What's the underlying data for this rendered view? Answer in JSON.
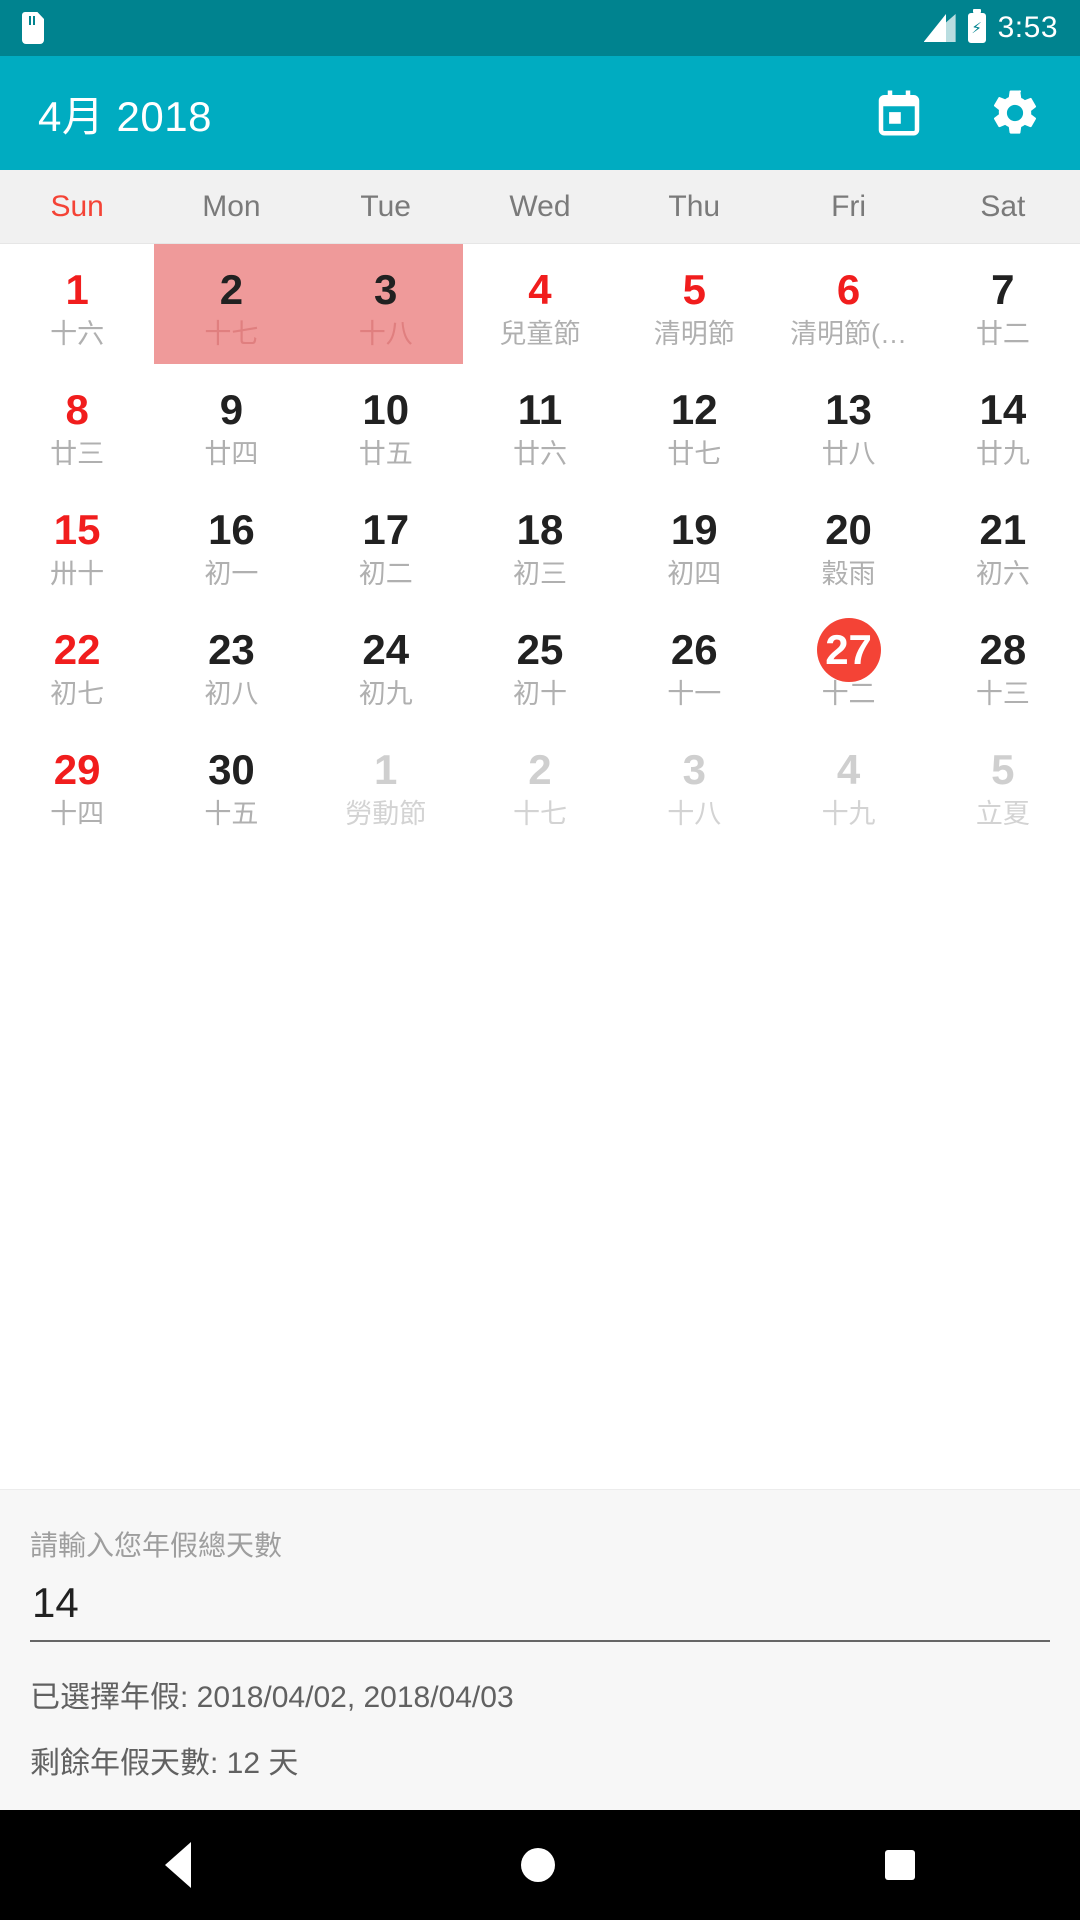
{
  "status_bar": {
    "time": "3:53",
    "icons": [
      "sd-card-icon",
      "signal-icon",
      "battery-charging-icon"
    ],
    "background_color": "#00838f"
  },
  "app_bar": {
    "title": "4月 2018",
    "background_color": "#00acc1",
    "actions": [
      {
        "name": "today-calendar-icon",
        "label": "Today"
      },
      {
        "name": "settings-gear-icon",
        "label": "Settings"
      }
    ]
  },
  "weekday_header": [
    {
      "label": "Sun",
      "weekend": true
    },
    {
      "label": "Mon",
      "weekend": false
    },
    {
      "label": "Tue",
      "weekend": false
    },
    {
      "label": "Wed",
      "weekend": false
    },
    {
      "label": "Thu",
      "weekend": false
    },
    {
      "label": "Fri",
      "weekend": false
    },
    {
      "label": "Sat",
      "weekend": false
    }
  ],
  "calendar": {
    "accent_selected_color": "#ef9a9a",
    "today_color": "#f44336",
    "holiday_color": "#f11d1d",
    "weeks": [
      [
        {
          "day": "1",
          "lunar": "十六",
          "red": true,
          "selected": false,
          "today": false,
          "out": false
        },
        {
          "day": "2",
          "lunar": "十七",
          "red": false,
          "selected": true,
          "today": false,
          "out": false
        },
        {
          "day": "3",
          "lunar": "十八",
          "red": false,
          "selected": true,
          "today": false,
          "out": false
        },
        {
          "day": "4",
          "lunar": "兒童節",
          "red": true,
          "selected": false,
          "today": false,
          "out": false
        },
        {
          "day": "5",
          "lunar": "清明節",
          "red": true,
          "selected": false,
          "today": false,
          "out": false
        },
        {
          "day": "6",
          "lunar": "清明節(…",
          "red": true,
          "selected": false,
          "today": false,
          "out": false
        },
        {
          "day": "7",
          "lunar": "廿二",
          "red": false,
          "selected": false,
          "today": false,
          "out": false
        }
      ],
      [
        {
          "day": "8",
          "lunar": "廿三",
          "red": true,
          "selected": false,
          "today": false,
          "out": false
        },
        {
          "day": "9",
          "lunar": "廿四",
          "red": false,
          "selected": false,
          "today": false,
          "out": false
        },
        {
          "day": "10",
          "lunar": "廿五",
          "red": false,
          "selected": false,
          "today": false,
          "out": false
        },
        {
          "day": "11",
          "lunar": "廿六",
          "red": false,
          "selected": false,
          "today": false,
          "out": false
        },
        {
          "day": "12",
          "lunar": "廿七",
          "red": false,
          "selected": false,
          "today": false,
          "out": false
        },
        {
          "day": "13",
          "lunar": "廿八",
          "red": false,
          "selected": false,
          "today": false,
          "out": false
        },
        {
          "day": "14",
          "lunar": "廿九",
          "red": false,
          "selected": false,
          "today": false,
          "out": false
        }
      ],
      [
        {
          "day": "15",
          "lunar": "卅十",
          "red": true,
          "selected": false,
          "today": false,
          "out": false
        },
        {
          "day": "16",
          "lunar": "初一",
          "red": false,
          "selected": false,
          "today": false,
          "out": false
        },
        {
          "day": "17",
          "lunar": "初二",
          "red": false,
          "selected": false,
          "today": false,
          "out": false
        },
        {
          "day": "18",
          "lunar": "初三",
          "red": false,
          "selected": false,
          "today": false,
          "out": false
        },
        {
          "day": "19",
          "lunar": "初四",
          "red": false,
          "selected": false,
          "today": false,
          "out": false
        },
        {
          "day": "20",
          "lunar": "穀雨",
          "red": false,
          "selected": false,
          "today": false,
          "out": false
        },
        {
          "day": "21",
          "lunar": "初六",
          "red": false,
          "selected": false,
          "today": false,
          "out": false
        }
      ],
      [
        {
          "day": "22",
          "lunar": "初七",
          "red": true,
          "selected": false,
          "today": false,
          "out": false
        },
        {
          "day": "23",
          "lunar": "初八",
          "red": false,
          "selected": false,
          "today": false,
          "out": false
        },
        {
          "day": "24",
          "lunar": "初九",
          "red": false,
          "selected": false,
          "today": false,
          "out": false
        },
        {
          "day": "25",
          "lunar": "初十",
          "red": false,
          "selected": false,
          "today": false,
          "out": false
        },
        {
          "day": "26",
          "lunar": "十一",
          "red": false,
          "selected": false,
          "today": false,
          "out": false
        },
        {
          "day": "27",
          "lunar": "十二",
          "red": false,
          "selected": false,
          "today": true,
          "out": false
        },
        {
          "day": "28",
          "lunar": "十三",
          "red": false,
          "selected": false,
          "today": false,
          "out": false
        }
      ],
      [
        {
          "day": "29",
          "lunar": "十四",
          "red": true,
          "selected": false,
          "today": false,
          "out": false
        },
        {
          "day": "30",
          "lunar": "十五",
          "red": false,
          "selected": false,
          "today": false,
          "out": false
        },
        {
          "day": "1",
          "lunar": "勞動節",
          "red": false,
          "selected": false,
          "today": false,
          "out": true
        },
        {
          "day": "2",
          "lunar": "十七",
          "red": false,
          "selected": false,
          "today": false,
          "out": true
        },
        {
          "day": "3",
          "lunar": "十八",
          "red": false,
          "selected": false,
          "today": false,
          "out": true
        },
        {
          "day": "4",
          "lunar": "十九",
          "red": false,
          "selected": false,
          "today": false,
          "out": true
        },
        {
          "day": "5",
          "lunar": "立夏",
          "red": false,
          "selected": false,
          "today": false,
          "out": true
        }
      ]
    ]
  },
  "form": {
    "label": "請輸入您年假總天數",
    "value": "14",
    "placeholder": "請輸入您年假總天數",
    "selected_line": "已選擇年假: 2018/04/02, 2018/04/03",
    "remaining_line": "剩餘年假天數: 12 天"
  },
  "nav_bar": {
    "buttons": [
      "back-button",
      "home-button",
      "recents-button"
    ],
    "background_color": "#000000"
  }
}
